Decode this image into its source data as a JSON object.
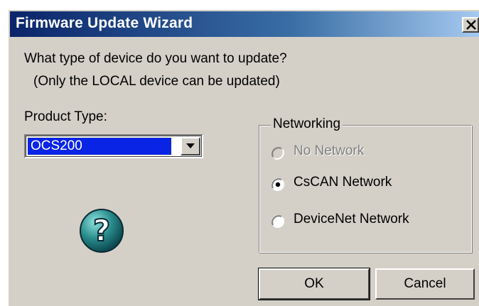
{
  "window": {
    "title": "Firmware Update Wizard",
    "close_icon": "close-icon"
  },
  "prompt": {
    "question": "What type of device do you want to update?",
    "note": "(Only the LOCAL device can be updated)"
  },
  "product": {
    "label": "Product Type:",
    "selected": "OCS200",
    "dropdown_icon": "chevron-down-icon"
  },
  "help": {
    "icon": "question-help-icon",
    "glyph": "?"
  },
  "networking": {
    "group_label": "Networking",
    "options": [
      {
        "label": "No Network",
        "checked": false,
        "disabled": true
      },
      {
        "label": "CsCAN Network",
        "checked": true,
        "disabled": false
      },
      {
        "label": "DeviceNet Network",
        "checked": false,
        "disabled": false
      }
    ]
  },
  "buttons": {
    "ok_label": "OK",
    "cancel_label": "Cancel"
  },
  "colors": {
    "title_bar_start": "#0a246a",
    "title_bar_end": "#a6caf0",
    "dialog_face": "#d4d0c8",
    "selection": "#0a24e6",
    "help_icon": "#2a8c8c"
  }
}
